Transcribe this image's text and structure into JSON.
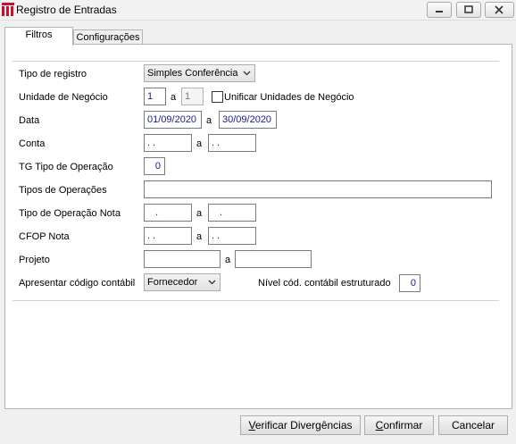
{
  "window": {
    "title": "Registro de Entradas"
  },
  "tabs": {
    "filtros": "Filtros",
    "configuracoes": "Configurações"
  },
  "form": {
    "tipo_registro": {
      "label": "Tipo de registro",
      "value": "Simples Conferência"
    },
    "unidade_negocio": {
      "label": "Unidade de Negócio",
      "from": "1",
      "sep": "a",
      "to": "1",
      "checkbox_label": "Unificar Unidades de Negócio"
    },
    "data": {
      "label": "Data",
      "from": "01/09/2020",
      "sep": "a",
      "to": "30/09/2020"
    },
    "conta": {
      "label": "Conta",
      "from": " .  .",
      "sep": "a",
      "to": " .  ."
    },
    "tg_tipo_operacao": {
      "label": "TG Tipo de Operação",
      "value": "0"
    },
    "tipos_operacoes": {
      "label": "Tipos de Operações",
      "value": ""
    },
    "tipo_operacao_nota": {
      "label": "Tipo de Operação Nota",
      "from": ".",
      "sep": "a",
      "to": "."
    },
    "cfop_nota": {
      "label": "CFOP Nota",
      "from": " .  .",
      "sep": "a",
      "to": " .  ."
    },
    "projeto": {
      "label": "Projeto",
      "from": "",
      "sep": "a",
      "to": ""
    },
    "codigo_contabil": {
      "label": "Apresentar código contábil",
      "value": "Fornecedor"
    },
    "nivel_contabil": {
      "label": "Nível cód. contábil estruturado",
      "value": "0"
    }
  },
  "buttons": {
    "verificar_first": "V",
    "verificar_rest": "erificar Divergências",
    "confirmar_first": "C",
    "confirmar_rest": "onfirmar",
    "cancelar": "Cancelar"
  },
  "colors": {
    "app_icon": "#c8102e",
    "field_text": "#1a1a8c"
  }
}
